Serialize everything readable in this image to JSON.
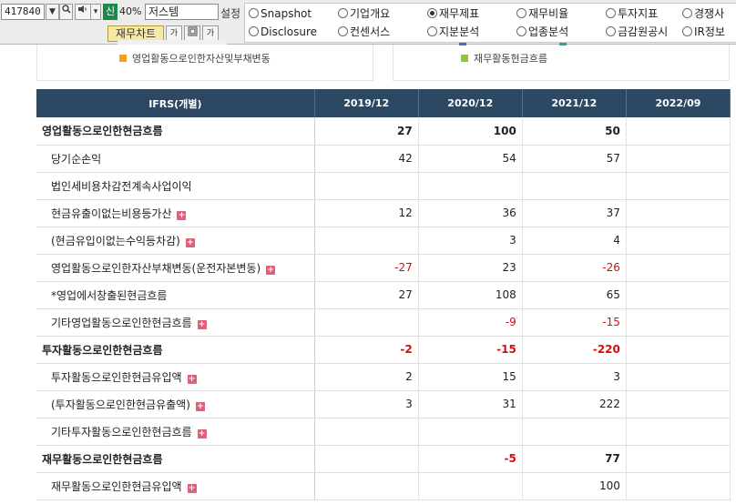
{
  "toolbar": {
    "stock_code": "417840",
    "badge": "신",
    "percent": "40%",
    "stock_name": "저스템",
    "settings_label": "설정",
    "chart_button": "재무차트"
  },
  "tabs": [
    {
      "label": "Snapshot",
      "selected": false
    },
    {
      "label": "기업개요",
      "selected": false
    },
    {
      "label": "재무제표",
      "selected": true
    },
    {
      "label": "재무비율",
      "selected": false
    },
    {
      "label": "투자지표",
      "selected": false
    },
    {
      "label": "경쟁사",
      "selected": false
    },
    {
      "label": "Disclosure",
      "selected": false
    },
    {
      "label": "컨센서스",
      "selected": false
    },
    {
      "label": "지분분석",
      "selected": false
    },
    {
      "label": "업종분석",
      "selected": false
    },
    {
      "label": "금감원공시",
      "selected": false
    },
    {
      "label": "IR정보",
      "selected": false
    }
  ],
  "legend": {
    "left_label": "영업활동으로인한자산및부채변동",
    "right_label": "재무활동현금흐름",
    "colors": {
      "orange": "#f0a020",
      "green": "#8dc63f",
      "blue": "#4a6fc0",
      "teal": "#2aa5a0"
    }
  },
  "table": {
    "header": [
      "IFRS(개별)",
      "2019/12",
      "2020/12",
      "2021/12",
      "2022/09"
    ],
    "rows": [
      {
        "label": "영업활동으로인한현금흐름",
        "main": true,
        "expand": false,
        "values": [
          "27",
          "100",
          "50",
          ""
        ]
      },
      {
        "label": "당기순손익",
        "main": false,
        "expand": false,
        "values": [
          "42",
          "54",
          "57",
          ""
        ]
      },
      {
        "label": "법인세비용차감전계속사업이익",
        "main": false,
        "expand": false,
        "values": [
          "",
          "",
          "",
          ""
        ]
      },
      {
        "label": "현금유출이없는비용등가산",
        "main": false,
        "expand": true,
        "values": [
          "12",
          "36",
          "37",
          ""
        ]
      },
      {
        "label": "(현금유입이없는수익등차감)",
        "main": false,
        "expand": true,
        "values": [
          "",
          "3",
          "4",
          ""
        ]
      },
      {
        "label": "영업활동으로인한자산부채변동(운전자본변동)",
        "main": false,
        "expand": true,
        "values": [
          "-27",
          "23",
          "-26",
          ""
        ]
      },
      {
        "label": "*영업에서창출된현금흐름",
        "main": false,
        "expand": false,
        "values": [
          "27",
          "108",
          "65",
          ""
        ]
      },
      {
        "label": "기타영업활동으로인한현금흐름",
        "main": false,
        "expand": true,
        "values": [
          "",
          "-9",
          "-15",
          ""
        ]
      },
      {
        "label": "투자활동으로인한현금흐름",
        "main": true,
        "expand": false,
        "values": [
          "-2",
          "-15",
          "-220",
          ""
        ]
      },
      {
        "label": "투자활동으로인한현금유입액",
        "main": false,
        "expand": true,
        "values": [
          "2",
          "15",
          "3",
          ""
        ]
      },
      {
        "label": "(투자활동으로인한현금유출액)",
        "main": false,
        "expand": true,
        "values": [
          "3",
          "31",
          "222",
          ""
        ]
      },
      {
        "label": "기타투자활동으로인한현금흐름",
        "main": false,
        "expand": true,
        "values": [
          "",
          "",
          "",
          ""
        ]
      },
      {
        "label": "재무활동으로인한현금흐름",
        "main": true,
        "expand": false,
        "values": [
          "",
          "-5",
          "77",
          ""
        ]
      },
      {
        "label": "재무활동으로인한현금유입액",
        "main": false,
        "expand": true,
        "values": [
          "",
          "",
          "100",
          ""
        ]
      }
    ]
  }
}
